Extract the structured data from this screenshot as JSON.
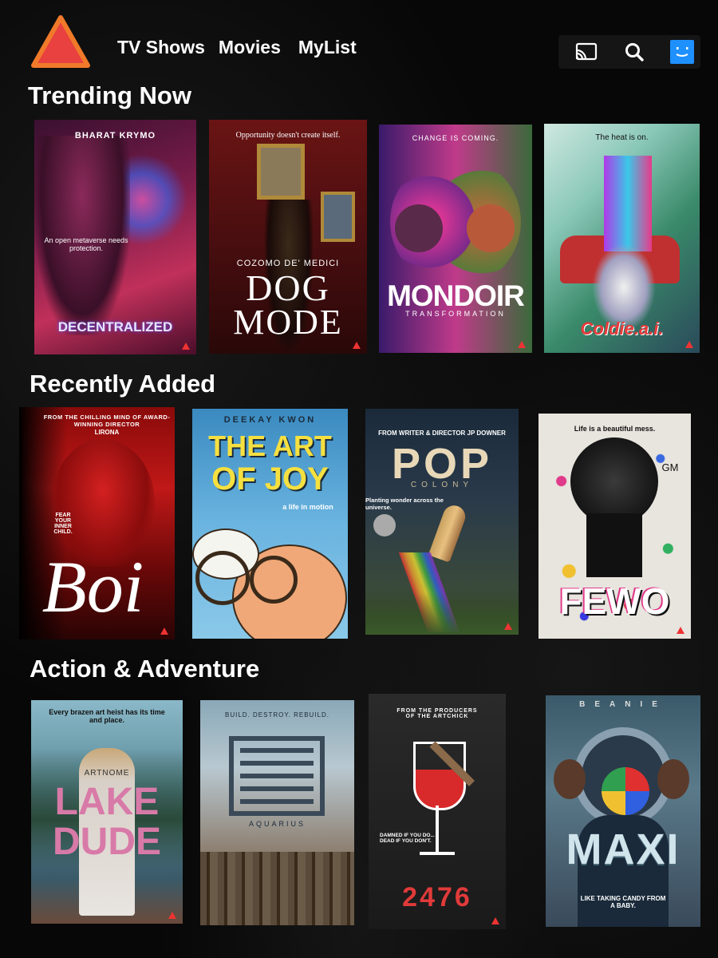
{
  "nav": {
    "items": [
      "TV Shows",
      "Movies",
      "MyList"
    ]
  },
  "sections": [
    {
      "title": "Trending Now"
    },
    {
      "title": "Recently Added"
    },
    {
      "title": "Action & Adventure"
    }
  ],
  "posters": {
    "decentralized": {
      "top": "BHARAT KRYMO",
      "tag": "An open metaverse needs protection.",
      "title": "DECENTRALIZED"
    },
    "dogmode": {
      "top": "Opportunity doesn't create itself.",
      "credit": "COZOMO DE' MEDICI",
      "title1": "DOG",
      "title2": "MODE"
    },
    "mondoir": {
      "top": "CHANGE IS COMING.",
      "title": "MONDOIR",
      "sub": "TRANSFORMATION"
    },
    "coldie": {
      "top": "The heat is on.",
      "title": "Coldie.a.i."
    },
    "boi": {
      "top": "FROM THE CHILLING MIND OF AWARD-WINNING DIRECTOR",
      "director": "LIRONA",
      "tag": "FEAR YOUR INNER CHILD.",
      "title": "Boi"
    },
    "artofjoy": {
      "top": "DEEKAY KWON",
      "title1": "THE ART",
      "title2": "OF JOY",
      "tag": "a life in motion"
    },
    "pop": {
      "top": "FROM WRITER & DIRECTOR JP DOWNER",
      "title": "POP",
      "sub": "COLONY",
      "tag": "Planting wonder across the universe."
    },
    "fewo": {
      "top": "Life is a beautiful mess.",
      "title": "FEWO",
      "corner": "GM"
    },
    "lakedude": {
      "top": "Every brazen art heist has its time and place.",
      "credit": "ARTNOME",
      "title1": "LAKE",
      "title2": "DUDE"
    },
    "aquarius": {
      "top": "BUILD. DESTROY. REBUILD.",
      "title": "AQUARIUS"
    },
    "p2476": {
      "top": "FROM THE PRODUCERS OF THE ARTCHICK",
      "tag": "DAMNED IF YOU DO... DEAD IF YOU DON'T.",
      "title": "2476"
    },
    "maxi": {
      "top": "BEANIE",
      "title": "MAXI",
      "tag": "LIKE TAKING CANDY FROM A BABY."
    }
  },
  "icons": {
    "cast": "cast-icon",
    "search": "search-icon",
    "profile": "profile-icon"
  },
  "colors": {
    "accent": "#e8413f",
    "profile": "#1e90ff"
  }
}
